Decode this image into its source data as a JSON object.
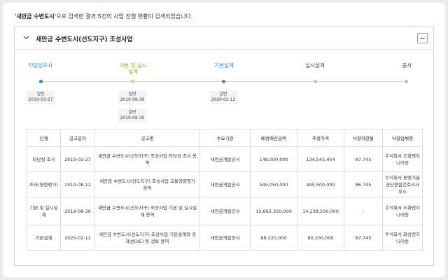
{
  "summary": {
    "keyword": "'새만금 수변도시'",
    "part1": "으로 검색한 결과 ",
    "count": "5",
    "part2": "건의 사업 진행 현황이 검색되었습니다."
  },
  "panel": {
    "title": "새만금 수변도시(선도지구) 조성사업"
  },
  "timeline": {
    "steps": [
      {
        "label": "타당성조사"
      },
      {
        "label_line1": "기본 및 실시",
        "label_line2": "설계"
      },
      {
        "label": "기본설계"
      },
      {
        "label": "실시설계"
      },
      {
        "label": "공사"
      }
    ],
    "dates": [
      {
        "type": "일반",
        "date": "2019-03-27"
      },
      {
        "type": "일반",
        "date": "2019-08-30"
      },
      {
        "type": "일반",
        "date": "2019-08-30"
      },
      {
        "type": "일반",
        "date": "2020-02-12"
      }
    ]
  },
  "table": {
    "headers": [
      "단계",
      "공고일자",
      "공고명",
      "수요기관",
      "배정예산금액",
      "추정가격",
      "낙찰하한율",
      "낙찰업체명"
    ],
    "rows": [
      {
        "stage": "타당성 조사",
        "date": "2019-03-27",
        "name": "새만금 수변도시(선도지구) 조성사업 타당성 조사 용역",
        "agency": "새만금개발공사",
        "budget": "148,000,000",
        "estimate": "134,545,454",
        "rate": "87.745",
        "company": "주식회사 도화엔지니어링"
      },
      {
        "stage": "조사(영향평가)",
        "date": "2019-08-12",
        "name": "새만금 수변도시(선도지구) 조성사업 교통영향평가 용역",
        "agency": "새만금개발공사",
        "budget": "545,050,000",
        "estimate": "495,500,000",
        "rate": "86.745",
        "company": "주식회사 동명기술공단종합건축사사무소"
      },
      {
        "stage": "기본 및 실시설계",
        "date": "2019-08-30",
        "name": "새만금 수변도시(선도지구) 조성사업 기본 및 실시설계 용역",
        "agency": "새만금개발공사",
        "budget": "15,662,350,000",
        "estimate": "14,238,500,000",
        "rate": "-",
        "company": "주식회사 도화엔지니어링"
      },
      {
        "stage": "기본설계",
        "date": "2020-02-12",
        "name": "새만금 수변도시(선도지구) 조성사업 기본설계의 경제성(VE) 등 검토 용역",
        "agency": "새만금개발공사",
        "budget": "88,220,000",
        "estimate": "80,200,000",
        "rate": "87.745",
        "company": "주식회사 화성엔지니어링"
      }
    ]
  },
  "colors": {
    "accent_blue": "#2d8ae6",
    "accent_green": "#8aaa1f",
    "pending_gray": "#bbbbbb"
  }
}
